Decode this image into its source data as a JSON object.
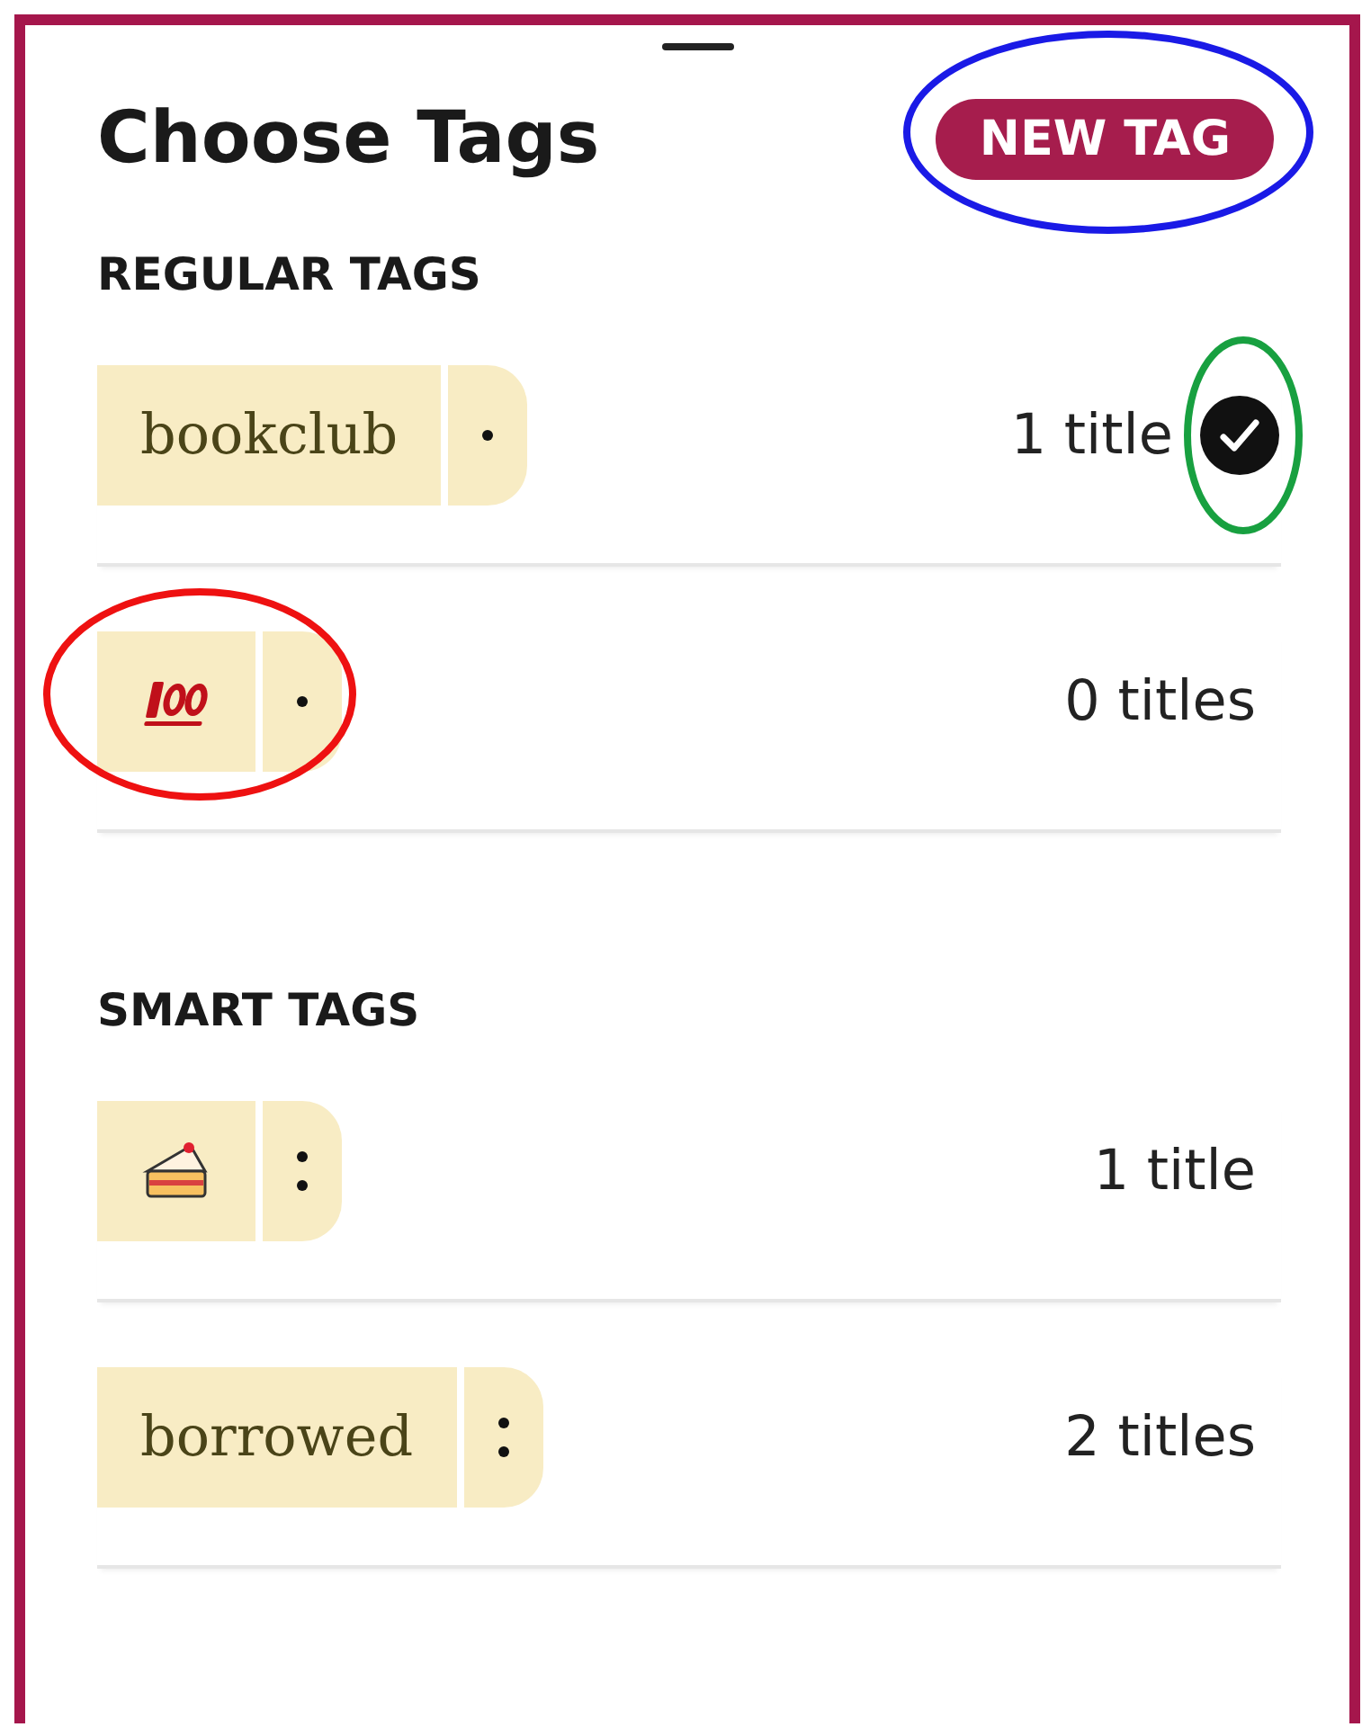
{
  "title": "Choose Tags",
  "new_tag_button": {
    "label": "NEW TAG",
    "highlight": {
      "color": "#1a1ae6"
    }
  },
  "sections": [
    {
      "heading": "REGULAR TAGS",
      "kind": "regular",
      "tags": [
        {
          "kind": "text",
          "label": "bookclub",
          "count": "1 title",
          "selected": true,
          "check_highlight": {
            "color": "#18a040"
          }
        },
        {
          "kind": "hundred",
          "count": "0 titles",
          "selected": false,
          "tag_highlight": {
            "color": "#ee1111"
          }
        }
      ]
    },
    {
      "heading": "SMART TAGS",
      "kind": "smart",
      "tags": [
        {
          "kind": "cake",
          "count": "1 title",
          "selected": false
        },
        {
          "kind": "text",
          "label": "borrowed",
          "count": "2 titles",
          "selected": false
        }
      ]
    }
  ]
}
